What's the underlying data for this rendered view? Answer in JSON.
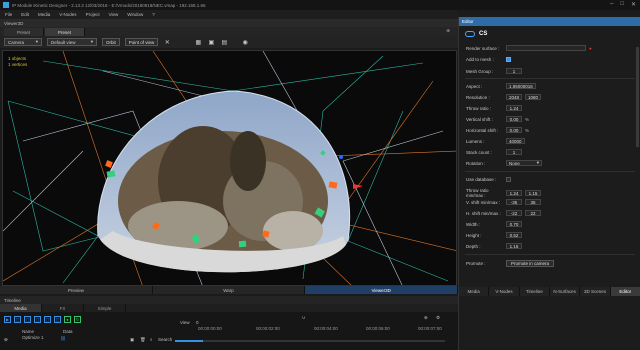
{
  "titlebar": {
    "title": "IP Module iKinetic Designer - 2.13.3 12/03/2018 - E:/Vmods/20180918/NEC.vmap - 192.168.1.66",
    "minimize": "–",
    "maximize": "□",
    "close": "✕"
  },
  "menu": [
    "File",
    "Edit",
    "Media",
    "V-Nodes",
    "Project",
    "View",
    "Window",
    "?"
  ],
  "viewport_panel": {
    "title": "Viewer3D"
  },
  "preset_tabs": [
    "Preset",
    "Preset"
  ],
  "toolbar": {
    "camera_select": "Camera",
    "view_select": "Default view",
    "orbit_label": "Orbit",
    "point_of_view_label": "Point of view"
  },
  "viewport": {
    "info_line1": "1 objects",
    "info_line2": "1 vertices"
  },
  "bottom_tabs": [
    "Preview",
    "Warp",
    "Viewer3D"
  ],
  "timeline": {
    "title": "Timeline",
    "tabs": [
      "Media",
      "FX",
      "Simple"
    ],
    "ruler": [
      "00:00:00:00",
      "00:00:02:00",
      "00:00:04:00",
      "00:00:06:00",
      "00:00:07:00"
    ],
    "col_name": "Name",
    "col_data": "Data",
    "media_item": "Optimize 1",
    "view_label": "View",
    "search_label": "Search",
    "zoom_value": "0"
  },
  "editor": {
    "header": "Editor",
    "object_name": "CS",
    "fields": {
      "render_surface_label": "Render surface :",
      "add_to_mesh_label": "Add to mesh :",
      "mesh_group_label": "Mesh Group :",
      "mesh_group_value": "1",
      "aspect_label": "Aspect :",
      "aspect_value": "1.95000016",
      "resolution_label": "Resolution :",
      "resolution_w": "2048",
      "resolution_h": "1080",
      "throw_ratio_label": "Throw ratio :",
      "throw_ratio_value": "1.24",
      "vshift_label": "Vertical shift :",
      "vshift_value": "0.00",
      "hshift_label": "Horizontal shift :",
      "hshift_value": "0.00",
      "lumens_label": "Lumens :",
      "lumens_value": "40000",
      "stack_count_label": "Stack count :",
      "stack_count_value": "1",
      "rotation_label": "Rotation :",
      "rotation_value": "None",
      "use_database_label": "Use database :",
      "throw_minmax_label": "Throw ratio min/max :",
      "throw_min": "1.24",
      "throw_max": "1.15",
      "vshift_minmax_label": "V. shift min/max :",
      "vshift_min": "-35",
      "vshift_max": "35",
      "hshift_minmax_label": "H. shift min/max :",
      "hshift_min": "-22",
      "hshift_max": "22",
      "width_label": "Width :",
      "width_value": "0.70",
      "height_label": "Height :",
      "height_value": "0.52",
      "depth_label": "Depth :",
      "depth_value": "1.16",
      "percent": "%",
      "promote_label": "Promote :",
      "promote_button": "Promote in camera"
    },
    "tabs": [
      "Media",
      "V-Nodes",
      "Timeline",
      "N-Surfaces",
      "3D Scenes",
      "Editor"
    ]
  },
  "colors": {
    "accent": "#2e6ca8",
    "active_tab": "#1f3f66",
    "orange": "#ff6a1a",
    "green": "#35d07f",
    "teal": "#2bb8a4"
  }
}
